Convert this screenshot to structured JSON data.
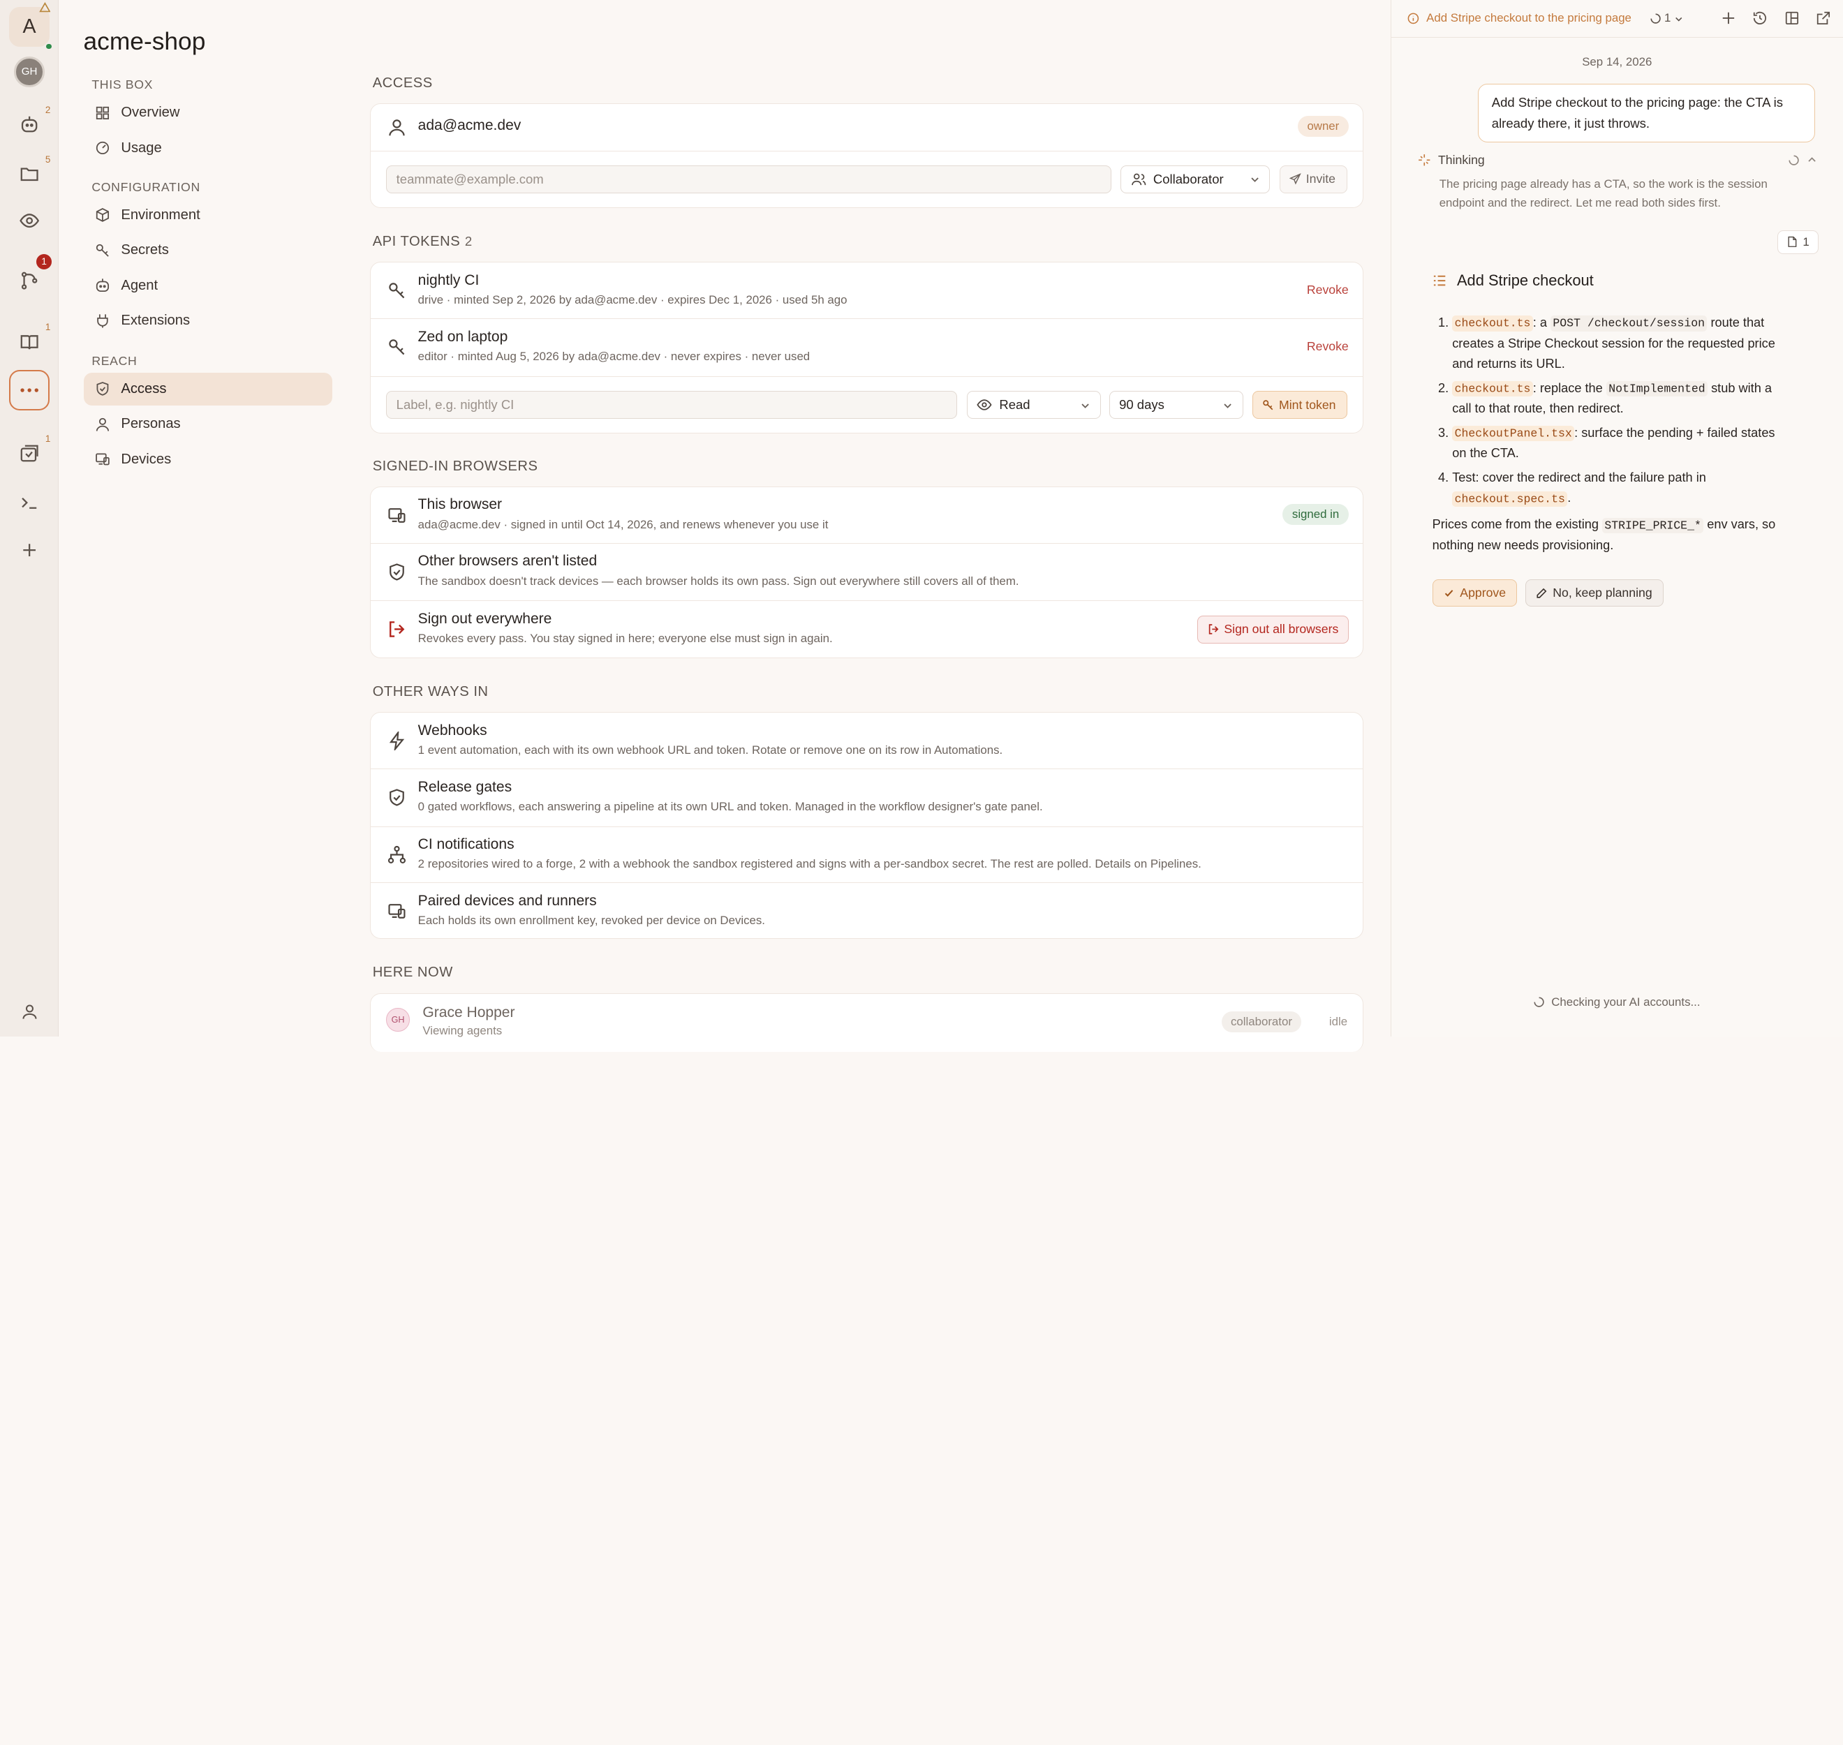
{
  "rail": {
    "avatar_letter": "A",
    "user_initials": "GH",
    "badges": {
      "agents": "2",
      "files": "5",
      "pull_requests": "1",
      "docs": "1",
      "deployments": "1"
    }
  },
  "sidebar": {
    "title": "acme-shop",
    "sections": [
      {
        "heading": "THIS BOX",
        "items": [
          {
            "label": "Overview"
          },
          {
            "label": "Usage"
          }
        ]
      },
      {
        "heading": "CONFIGURATION",
        "items": [
          {
            "label": "Environment"
          },
          {
            "label": "Secrets"
          },
          {
            "label": "Agent"
          },
          {
            "label": "Extensions"
          }
        ]
      },
      {
        "heading": "REACH",
        "items": [
          {
            "label": "Access"
          },
          {
            "label": "Personas"
          },
          {
            "label": "Devices"
          }
        ]
      }
    ]
  },
  "access": {
    "heading": "ACCESS",
    "owner_email": "ada@acme.dev",
    "owner_badge": "owner",
    "invite_placeholder": "teammate@example.com",
    "role_value": "Collaborator",
    "invite_label": "Invite"
  },
  "tokens": {
    "heading": "API TOKENS",
    "count": "2",
    "items": [
      {
        "name": "nightly CI",
        "meta": "drive · minted Sep 2, 2026 by ada@acme.dev · expires Dec 1, 2026 · used 5h ago",
        "action": "Revoke"
      },
      {
        "name": "Zed on laptop",
        "meta": "editor · minted Aug 5, 2026 by ada@acme.dev · never expires · never used",
        "action": "Revoke"
      }
    ],
    "label_placeholder": "Label, e.g. nightly CI",
    "scope_value": "Read",
    "expiry_value": "90 days",
    "mint_label": "Mint token"
  },
  "browsers": {
    "heading": "SIGNED-IN BROWSERS",
    "this_title": "This browser",
    "this_meta": "ada@acme.dev · signed in until Oct 14, 2026, and renews whenever you use it",
    "this_badge": "signed in",
    "other_title": "Other browsers aren't listed",
    "other_meta": "The sandbox doesn't track devices — each browser holds its own pass. Sign out everywhere still covers all of them.",
    "signout_title": "Sign out everywhere",
    "signout_meta": "Revokes every pass. You stay signed in here; everyone else must sign in again.",
    "signout_button": "Sign out all browsers"
  },
  "other_ways": {
    "heading": "OTHER WAYS IN",
    "items": [
      {
        "title": "Webhooks",
        "meta": "1 event automation, each with its own webhook URL and token. Rotate or remove one on its row in Automations."
      },
      {
        "title": "Release gates",
        "meta": "0 gated workflows, each answering a pipeline at its own URL and token. Managed in the workflow designer's gate panel."
      },
      {
        "title": "CI notifications",
        "meta": "2 repositories wired to a forge, 2 with a webhook the sandbox registered and signs with a per-sandbox secret. The rest are polled. Details on Pipelines."
      },
      {
        "title": "Paired devices and runners",
        "meta": "Each holds its own enrollment key, revoked per device on Devices."
      }
    ]
  },
  "here_now": {
    "heading": "HERE NOW",
    "person": {
      "initials": "GH",
      "name": "Grace Hopper",
      "activity": "Viewing agents",
      "role": "collaborator",
      "status": "idle"
    }
  },
  "chat": {
    "tab_title": "Add Stripe checkout to the pricing page",
    "run_count": "1",
    "date": "Sep 14, 2026",
    "user_message": "Add Stripe checkout to the pricing page: the CTA is already there, it just throws.",
    "thinking_label": "Thinking",
    "thinking_text": "The pricing page already has a CTA, so the work is the session endpoint and the redirect. Let me read both sides first.",
    "files_count": "1",
    "plan_title": "Add Stripe checkout",
    "plan": {
      "s1_file": "checkout.ts",
      "s1_a": ": a ",
      "s1_code": "POST /checkout/session",
      "s1_b": " route that creates a Stripe Checkout session for the requested price and returns its URL.",
      "s2_file": "checkout.ts",
      "s2_a": ": replace the ",
      "s2_code": "NotImplemented",
      "s2_b": " stub with a call to that route, then redirect.",
      "s3_file": "CheckoutPanel.tsx",
      "s3_a": ": surface the pending + failed states on the CTA.",
      "s4_a": "Test: cover the redirect and the failure path in ",
      "s4_file": "checkout.spec.ts",
      "s4_b": ".",
      "note_a": "Prices come from the existing ",
      "note_code": "STRIPE_PRICE_*",
      "note_b": " env vars, so nothing new needs provisioning."
    },
    "approve_label": "Approve",
    "keep_planning_label": "No, keep planning",
    "status": "Checking your AI accounts..."
  }
}
